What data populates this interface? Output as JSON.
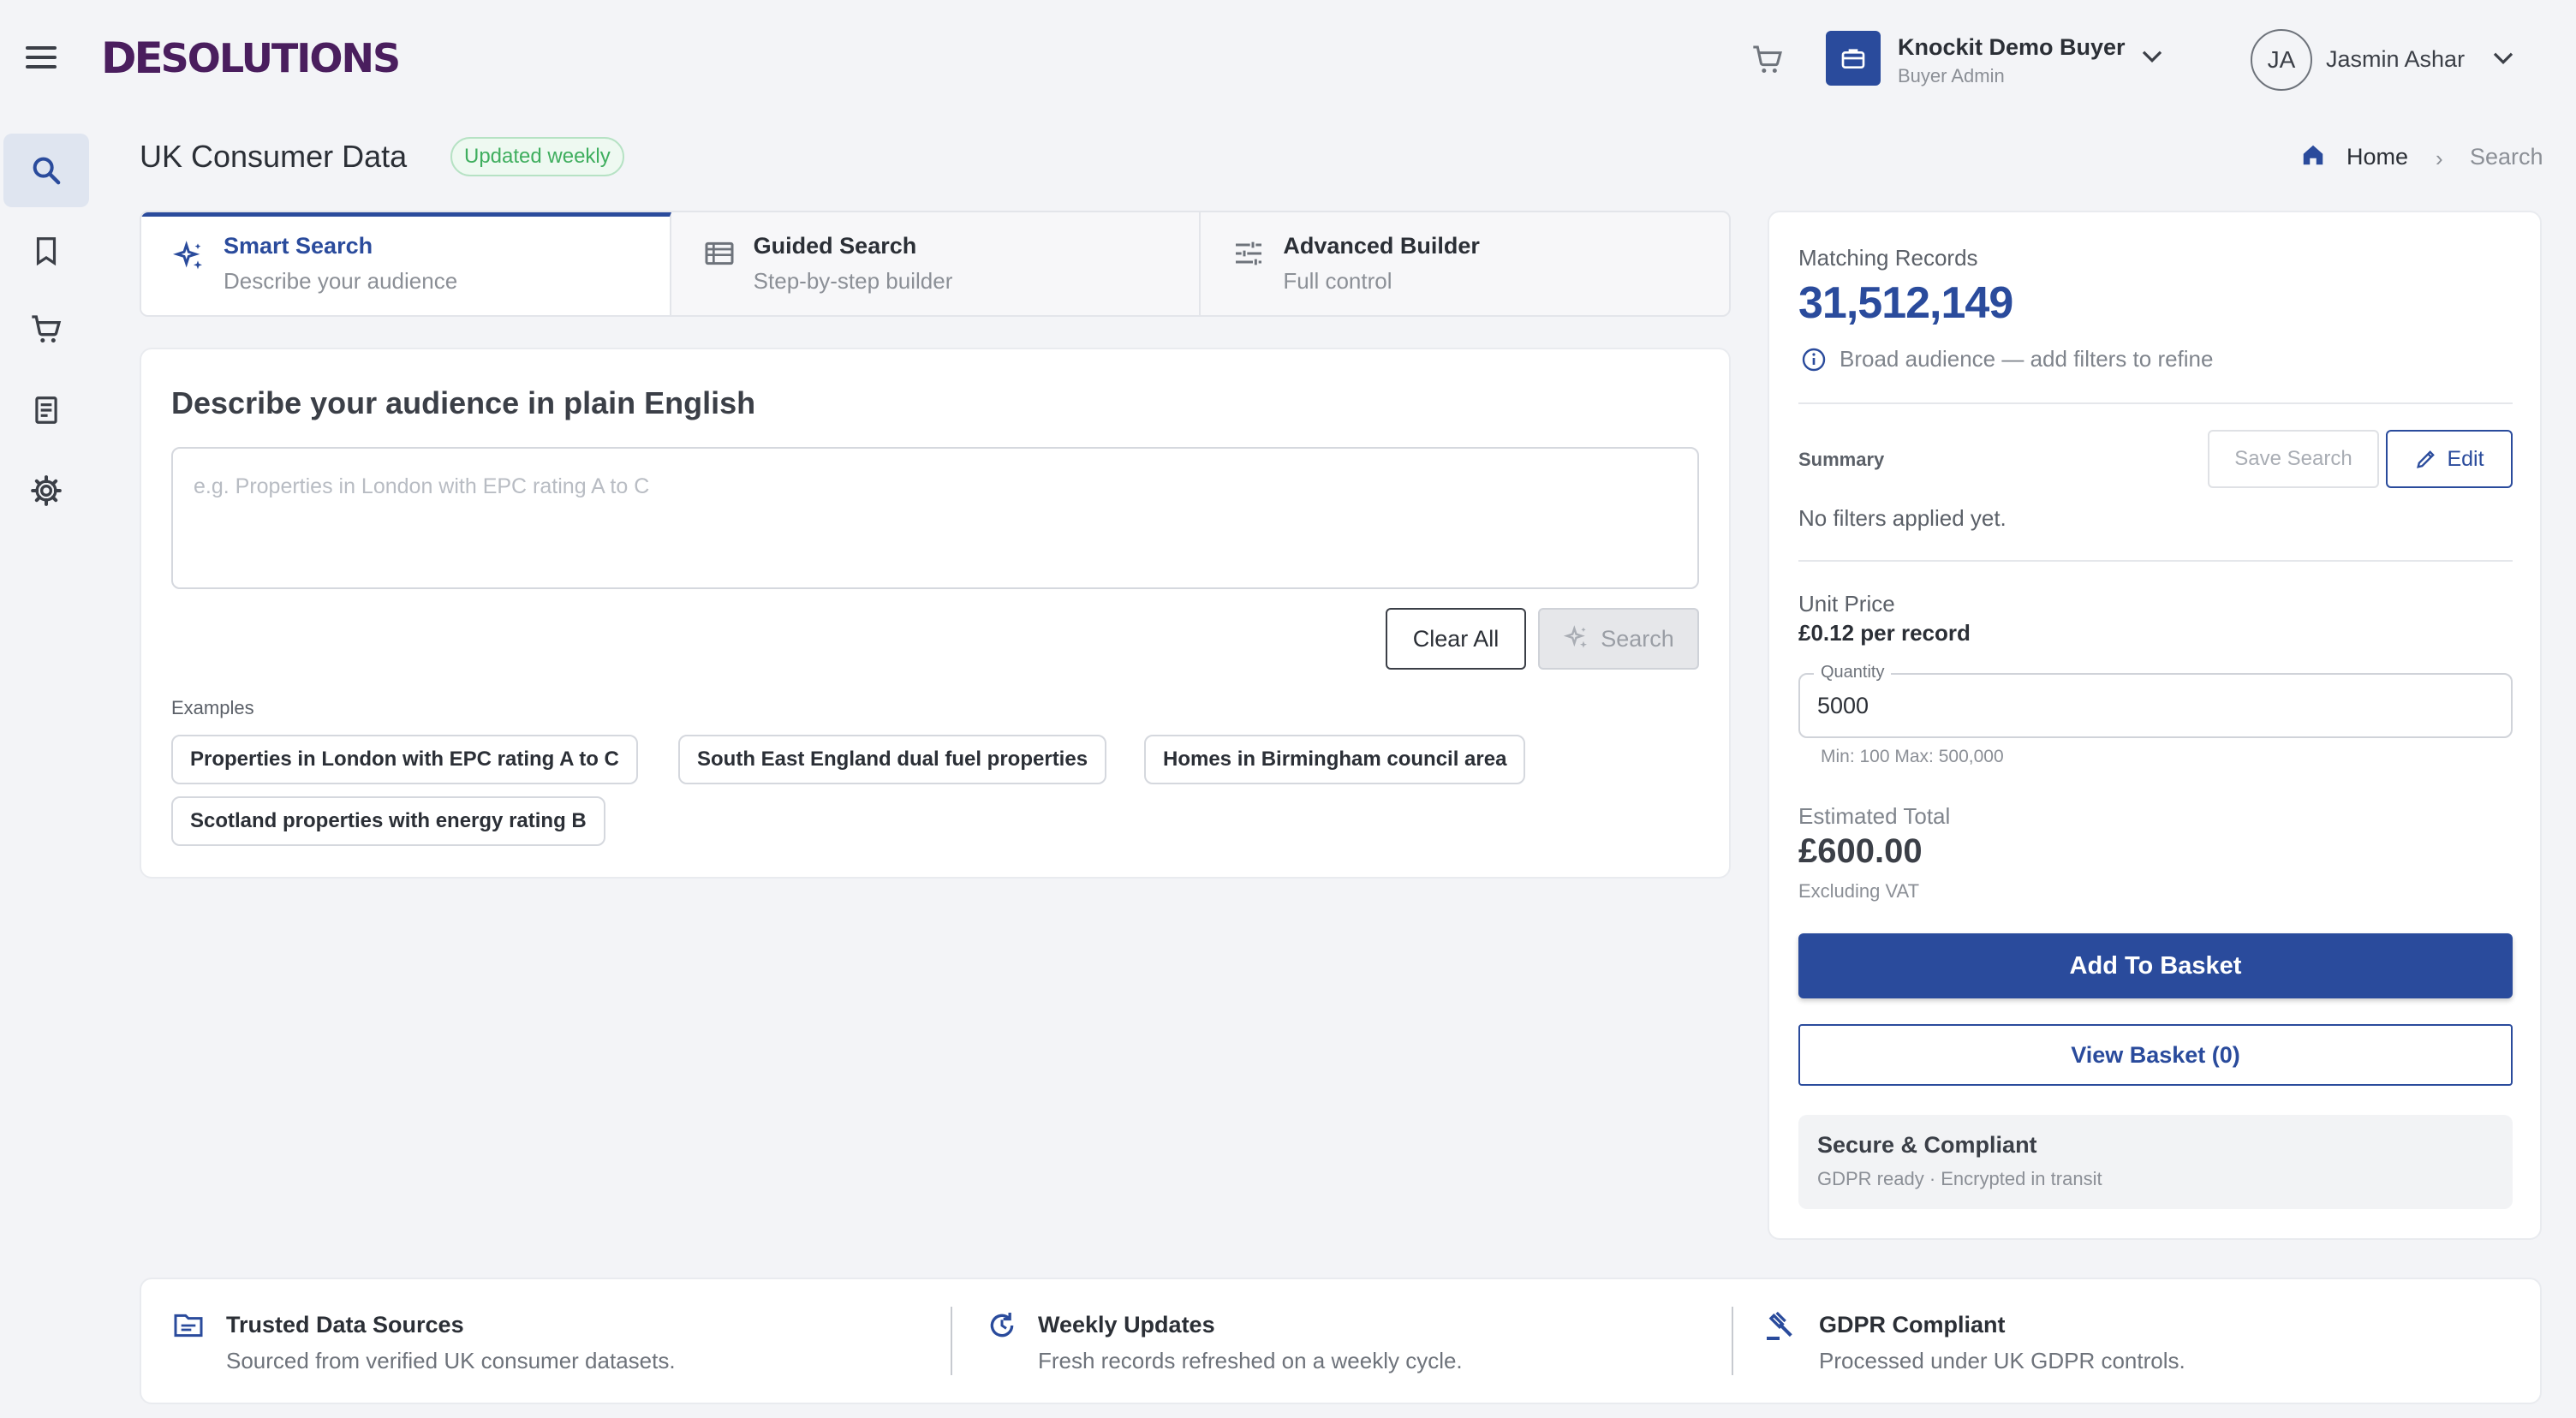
{
  "header": {
    "logo_text_a": "DE",
    "logo_text_b": "SOLUTIONS",
    "org_name": "Knockit Demo Buyer",
    "org_role": "Buyer Admin",
    "user_initials": "JA",
    "user_name": "Jasmin Ashar"
  },
  "sidebar": {
    "items": [
      {
        "name": "search",
        "icon": "search-icon",
        "active": true
      },
      {
        "name": "saved",
        "icon": "bookmark-icon",
        "active": false
      },
      {
        "name": "basket",
        "icon": "cart-icon",
        "active": false
      },
      {
        "name": "orders",
        "icon": "receipt-icon",
        "active": false
      },
      {
        "name": "settings",
        "icon": "gear-icon",
        "active": false
      }
    ]
  },
  "page": {
    "title": "UK Consumer Data",
    "badge": "Updated weekly",
    "breadcrumb": {
      "home": "Home",
      "separator": "›",
      "current": "Search"
    }
  },
  "tabs": [
    {
      "title": "Smart Search",
      "subtitle": "Describe your audience",
      "icon": "sparkle-icon",
      "active": true
    },
    {
      "title": "Guided Search",
      "subtitle": "Step-by-step builder",
      "icon": "list-icon",
      "active": false
    },
    {
      "title": "Advanced Builder",
      "subtitle": "Full control",
      "icon": "sliders-icon",
      "active": false
    }
  ],
  "smart_search": {
    "heading": "Describe your audience in plain English",
    "placeholder": "e.g. Properties in London with EPC rating A to C",
    "value": "",
    "clear_label": "Clear All",
    "search_label": "Search",
    "examples_label": "Examples",
    "examples": [
      "Properties in London with EPC rating A to C",
      "South East England dual fuel properties",
      "Homes in Birmingham council area",
      "Scotland properties with energy rating B"
    ]
  },
  "summary_panel": {
    "matching_label": "Matching Records",
    "matching_value": "31,512,149",
    "matching_info": "Broad audience — add filters to refine",
    "summary_label": "Summary",
    "save_label": "Save Search",
    "edit_label": "Edit",
    "summary_empty": "No filters applied yet.",
    "unit_price_label": "Unit Price",
    "unit_price_value": "£0.12 per record",
    "quantity_label": "Quantity",
    "quantity_value": "5000",
    "quantity_hint": "Min: 100 Max: 500,000",
    "estimated_label": "Estimated Total",
    "estimated_value": "£600.00",
    "estimated_vat": "Excluding VAT",
    "add_label": "Add To Basket",
    "view_label": "View Basket (0)",
    "secure_title": "Secure & Compliant",
    "secure_sub": "GDPR ready · Encrypted in transit"
  },
  "footer": [
    {
      "title": "Trusted Data Sources",
      "subtitle": "Sourced from verified UK consumer datasets.",
      "icon": "folder-icon"
    },
    {
      "title": "Weekly Updates",
      "subtitle": "Fresh records refreshed on a weekly cycle.",
      "icon": "refresh-icon"
    },
    {
      "title": "GDPR Compliant",
      "subtitle": "Processed under UK GDPR controls.",
      "icon": "gavel-icon"
    }
  ],
  "colors": {
    "primary": "#2a4b9c",
    "logo": "#4a1e5e",
    "badge_green": "#3fae5e",
    "background": "#f3f4f7"
  }
}
